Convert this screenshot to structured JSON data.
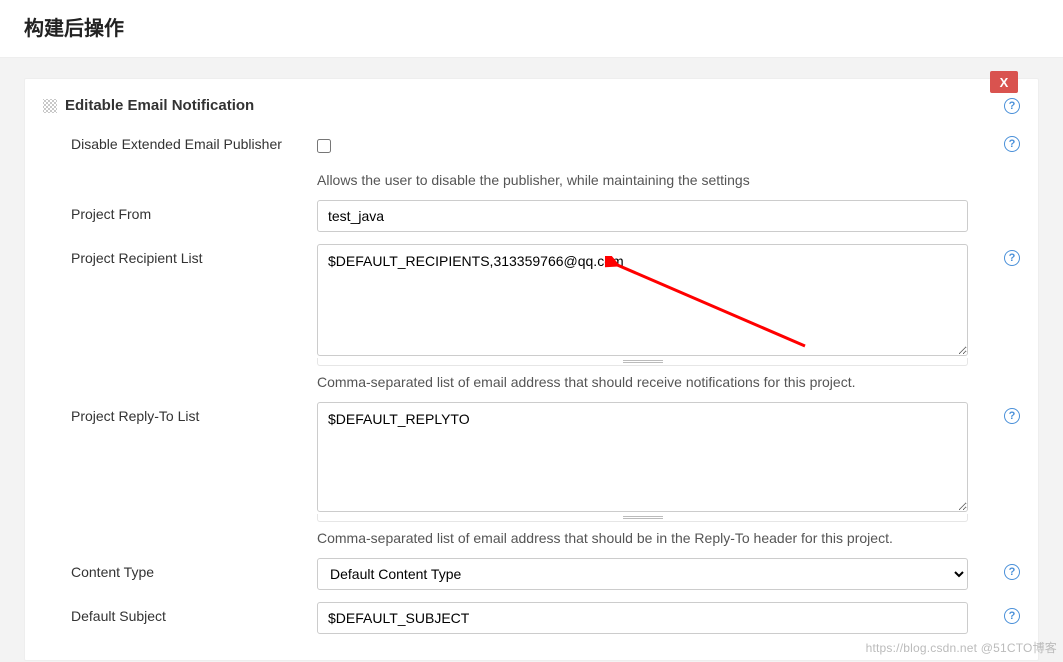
{
  "page": {
    "title": "构建后操作"
  },
  "section": {
    "title": "Editable Email Notification",
    "close_label": "X"
  },
  "form": {
    "disable_publisher": {
      "label": "Disable Extended Email Publisher",
      "checked": false,
      "desc": "Allows the user to disable the publisher, while maintaining the settings"
    },
    "project_from": {
      "label": "Project From",
      "value": "test_java"
    },
    "recipient_list": {
      "label": "Project Recipient List",
      "value": "$DEFAULT_RECIPIENTS,313359766@qq.com",
      "desc": "Comma-separated list of email address that should receive notifications for this project."
    },
    "reply_to": {
      "label": "Project Reply-To List",
      "value": "$DEFAULT_REPLYTO",
      "desc": "Comma-separated list of email address that should be in the Reply-To header for this project."
    },
    "content_type": {
      "label": "Content Type",
      "selected": "Default Content Type"
    },
    "default_subject": {
      "label": "Default Subject",
      "value": "$DEFAULT_SUBJECT"
    }
  },
  "watermark": "https://blog.csdn.net    @51CTO博客"
}
